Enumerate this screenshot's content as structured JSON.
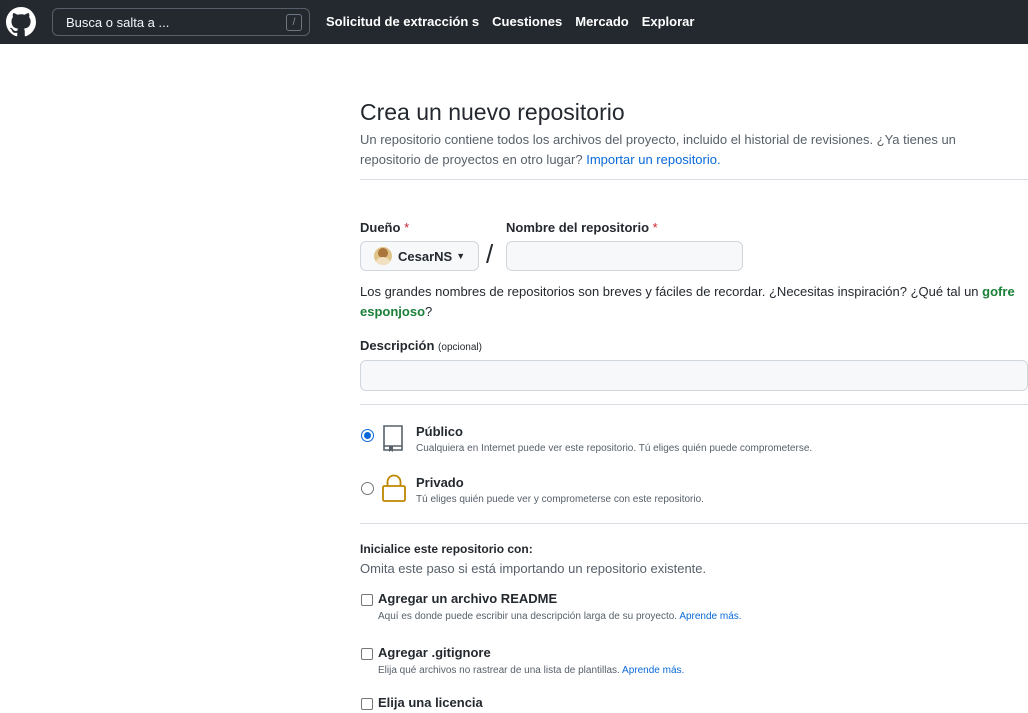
{
  "header": {
    "search_placeholder": "Busca o salta a ...",
    "search_key": "/",
    "nav": [
      "Solicitud de extracción s",
      "Cuestiones",
      "Mercado",
      "Explorar"
    ]
  },
  "page": {
    "title": "Crea un nuevo repositorio",
    "subtitle_text": "Un repositorio contiene todos los archivos del proyecto, incluido el historial de revisiones. ¿Ya tienes un repositorio de proyectos en otro lugar?",
    "subtitle_link": "Importar un repositorio."
  },
  "form": {
    "owner_label": "Dueño",
    "repo_label": "Nombre del repositorio",
    "required_mark": "*",
    "owner_name": "CesarNS",
    "repo_name_value": "",
    "separator": "/",
    "hint_text": "Los grandes nombres de repositorios son breves y fáciles de recordar. ¿Necesitas inspiración? ¿Qué tal un",
    "hint_suggestion": "gofre esponjoso",
    "hint_end": "?",
    "description_label": "Descripción",
    "description_optional": "(opcional)",
    "description_value": ""
  },
  "visibility": {
    "public_title": "Público",
    "public_desc": "Cualquiera en Internet puede ver este repositorio. Tú eliges quién puede comprometerse.",
    "private_title": "Privado",
    "private_desc": "Tú eliges quién puede ver y comprometerse con este repositorio.",
    "selected": "public"
  },
  "init": {
    "title": "Inicialice este repositorio con:",
    "subtitle": "Omita este paso si está importando un repositorio existente.",
    "readme_title": "Agregar un archivo README",
    "readme_desc": "Aquí es donde puede escribir una descripción larga de su proyecto.",
    "gitignore_title": "Agregar .gitignore",
    "gitignore_desc": "Elija qué archivos no rastrear de una lista de plantillas.",
    "license_title": "Elija una licencia",
    "learn_more": "Aprende más."
  },
  "colors": {
    "header_bg": "#24292f",
    "link": "#0969da",
    "suggestion": "#1a7f37",
    "required": "#cf222e",
    "lock_icon": "#bf8700"
  }
}
